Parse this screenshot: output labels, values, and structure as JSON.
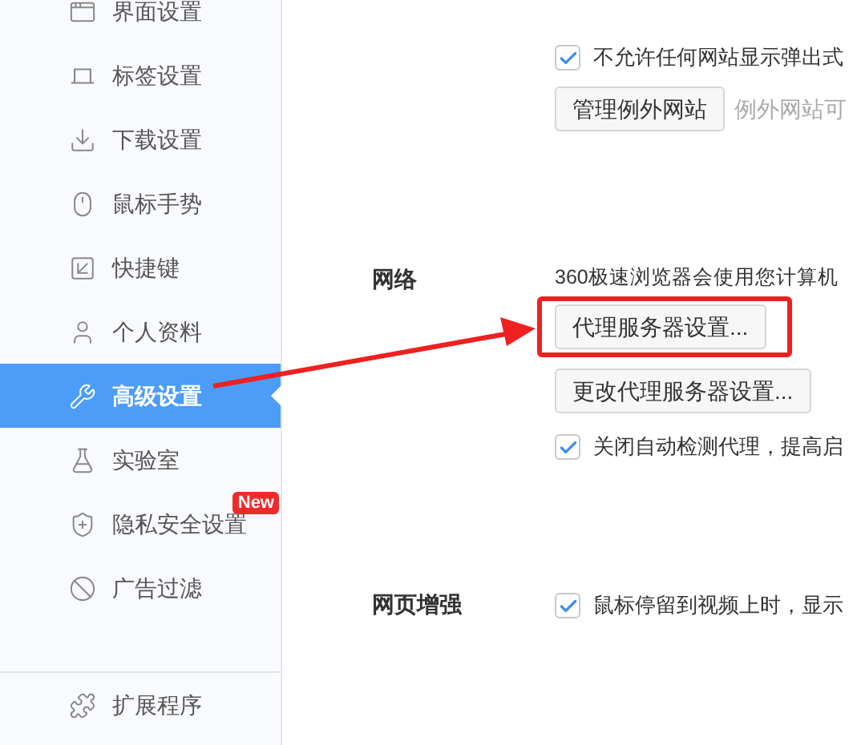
{
  "sidebar": {
    "items": [
      {
        "label": "界面设置",
        "selected": false
      },
      {
        "label": "标签设置",
        "selected": false
      },
      {
        "label": "下载设置",
        "selected": false
      },
      {
        "label": "鼠标手势",
        "selected": false
      },
      {
        "label": "快捷键",
        "selected": false
      },
      {
        "label": "个人资料",
        "selected": false
      },
      {
        "label": "高级设置",
        "selected": true
      },
      {
        "label": "实验室",
        "selected": false
      },
      {
        "label": "隐私安全设置",
        "selected": false,
        "badge": "New"
      },
      {
        "label": "广告过滤",
        "selected": false
      }
    ],
    "footer_item": {
      "label": "扩展程序"
    }
  },
  "popups": {
    "checkbox": {
      "label": "不允许任何网站显示弹出式",
      "checked": true
    },
    "button": "管理例外网站",
    "hint": "例外网站可"
  },
  "network": {
    "title": "网络",
    "description": "360极速浏览器会使用您计算机",
    "proxy_button": "代理服务器设置...",
    "change_button": "更改代理服务器设置...",
    "checkbox": {
      "label": "关闭自动检测代理，提高启",
      "checked": true
    }
  },
  "web_enhance": {
    "title": "网页增强",
    "checkbox": {
      "label": "鼠标停留到视频上时，显示",
      "checked": true
    }
  }
}
